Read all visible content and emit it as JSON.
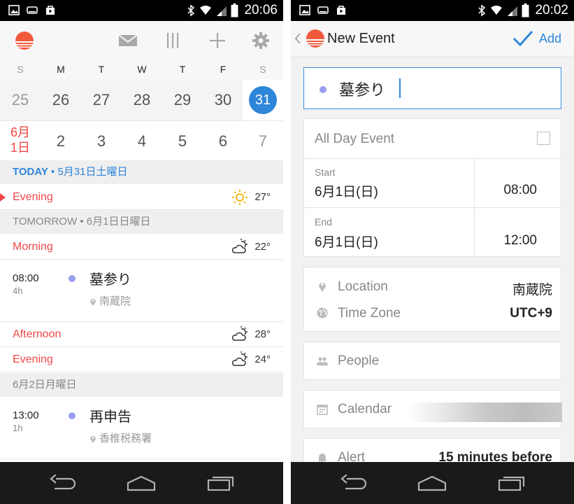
{
  "status_bar": {
    "time_left": "20:06",
    "time_right": "20:02"
  },
  "calendar_view": {
    "weekdays": [
      "S",
      "M",
      "T",
      "W",
      "T",
      "F",
      "S"
    ],
    "week1": [
      "25",
      "26",
      "27",
      "28",
      "29",
      "30",
      "31"
    ],
    "week2_month": "6月",
    "week2_first": "1日",
    "week2": [
      "2",
      "3",
      "4",
      "5",
      "6",
      "7"
    ],
    "today_header_label": "TODAY",
    "today_header_date": " • 5月31日土曜日",
    "today_rows": [
      {
        "period": "Evening",
        "temp": "27°",
        "icon": "sun-icon"
      }
    ],
    "tomorrow_header": "TOMORROW • 6月1日日曜日",
    "tomorrow_rows": [
      {
        "period": "Morning",
        "temp": "22°",
        "icon": "partly-cloudy-icon"
      },
      {
        "period": "Afternoon",
        "temp": "28°",
        "icon": "partly-cloudy-icon"
      },
      {
        "period": "Evening",
        "temp": "24°",
        "icon": "partly-cloudy-icon"
      }
    ],
    "event1": {
      "time": "08:00",
      "duration": "4h",
      "title": "墓参り",
      "location": "南蔵院"
    },
    "day3_header": "6月2日月曜日",
    "event2": {
      "time": "13:00",
      "duration": "1h",
      "title": "再申告",
      "location": "香椎税務署"
    }
  },
  "new_event": {
    "header_title": "New Event",
    "add_label": "Add",
    "title_value": "墓参り",
    "all_day_label": "All Day Event",
    "start_label": "Start",
    "start_date": "6月1日(日)",
    "start_time": "08:00",
    "end_label": "End",
    "end_date": "6月1日(日)",
    "end_time": "12:00",
    "location_label": "Location",
    "location_value": "南蔵院",
    "timezone_label": "Time Zone",
    "timezone_value": "UTC+9",
    "people_label": "People",
    "calendar_label": "Calendar",
    "alert_label": "Alert",
    "alert_value": "15 minutes before"
  },
  "colors": {
    "accent": "#2d86d9",
    "red": "#f04848",
    "event_dot": "#9a9cf0"
  }
}
